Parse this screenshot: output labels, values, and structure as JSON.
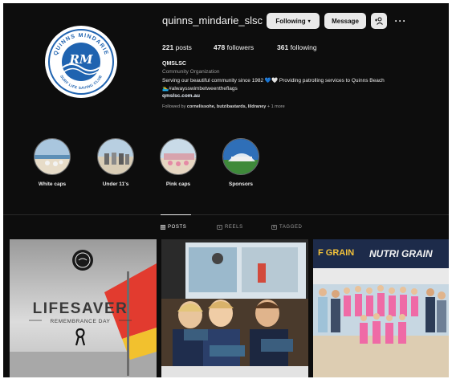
{
  "profile": {
    "username": "quinns_mindarie_slsc",
    "following_button": "Following",
    "message_button": "Message",
    "more_label": "···",
    "logo_top_text": "QUINNS MINDARIE",
    "logo_initials": "RM",
    "logo_bottom_text": "SURF LIFE SAVING CLUB"
  },
  "stats": {
    "posts_count": "221",
    "posts_label": "posts",
    "followers_count": "478",
    "followers_label": "followers",
    "following_count": "361",
    "following_label": "following"
  },
  "bio": {
    "name": "QMSLSC",
    "category": "Community Organization",
    "line1": "Serving our beautiful community since 1982 💙🤍 Providing patrolling services to Quinns Beach",
    "line2": "🏊‍♂️#alwaysswimbetweentheflags",
    "link": "qmslsc.com.au",
    "followed_prefix": "Followed by",
    "followed_names": "cornelissohe, butzibastards, lildraney",
    "followed_suffix": "+ 1 more"
  },
  "highlights": [
    {
      "label": "White caps"
    },
    {
      "label": "Under 11's"
    },
    {
      "label": "Pink caps"
    },
    {
      "label": "Sponsors"
    }
  ],
  "tabs": [
    {
      "label": "POSTS",
      "active": true
    },
    {
      "label": "REELS",
      "active": false
    },
    {
      "label": "TAGGED",
      "active": false
    }
  ],
  "posts": [
    {
      "title": "LIFESAVER",
      "subtitle": "REMEMBRANCE DAY"
    },
    {
      "description": "photo"
    },
    {
      "banner_left": "F GRAIN",
      "banner_right": "NUTRI GRAIN"
    }
  ],
  "colors": {
    "background": "#0d0d0d",
    "logo_blue": "#1f63b0",
    "button_bg": "#e9e9e9"
  }
}
